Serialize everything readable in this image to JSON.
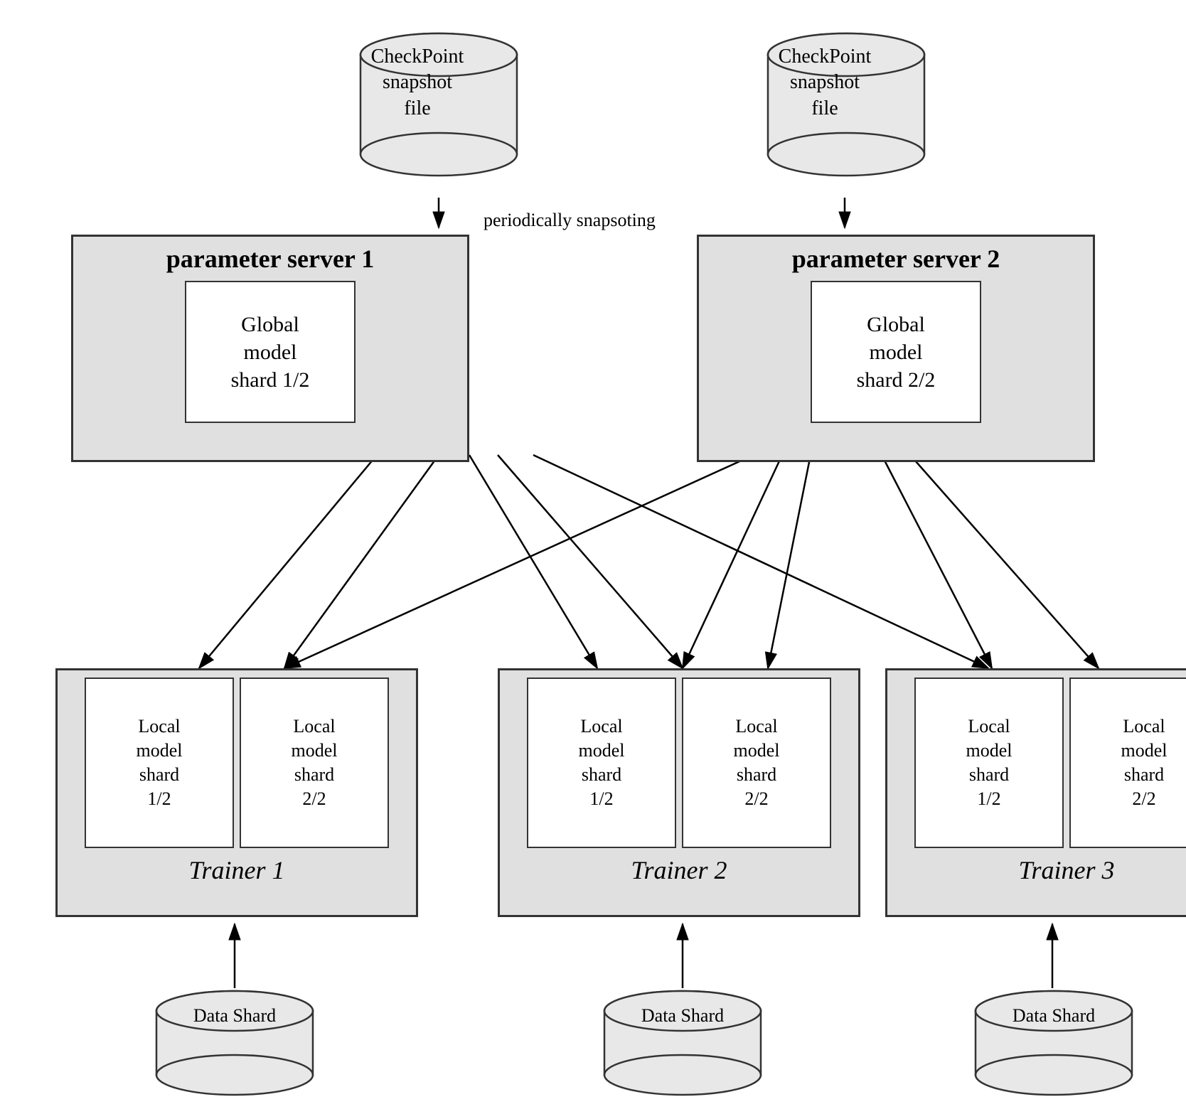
{
  "checkpoint1": {
    "label": "CheckPoint\nsnapshot\nfile",
    "lines": [
      "CheckPoint",
      "snapshot",
      "file"
    ]
  },
  "checkpoint2": {
    "label": "CheckPoint\nsnapshot\nfile",
    "lines": [
      "CheckPoint",
      "snapshot",
      "file"
    ]
  },
  "periodic_label": "periodically snapsoting",
  "server1": {
    "title": "parameter server 1",
    "inner": [
      "Global",
      "model",
      "shard 1/2"
    ]
  },
  "server2": {
    "title": "parameter server 2",
    "inner": [
      "Global",
      "model",
      "shard 2/2"
    ]
  },
  "trainer1": {
    "title": "Trainer 1",
    "shard1": [
      "Local",
      "model",
      "shard",
      "1/2"
    ],
    "shard2": [
      "Local",
      "model",
      "shard",
      "2/2"
    ]
  },
  "trainer2": {
    "title": "Trainer 2",
    "shard1": [
      "Local",
      "model",
      "shard",
      "1/2"
    ],
    "shard2": [
      "Local",
      "model",
      "shard",
      "2/2"
    ]
  },
  "trainer3": {
    "title": "Trainer 3",
    "shard1": [
      "Local",
      "model",
      "shard",
      "1/2"
    ],
    "shard2": [
      "Local",
      "model",
      "shard",
      "2/2"
    ]
  },
  "data_shard": "Data Shard"
}
